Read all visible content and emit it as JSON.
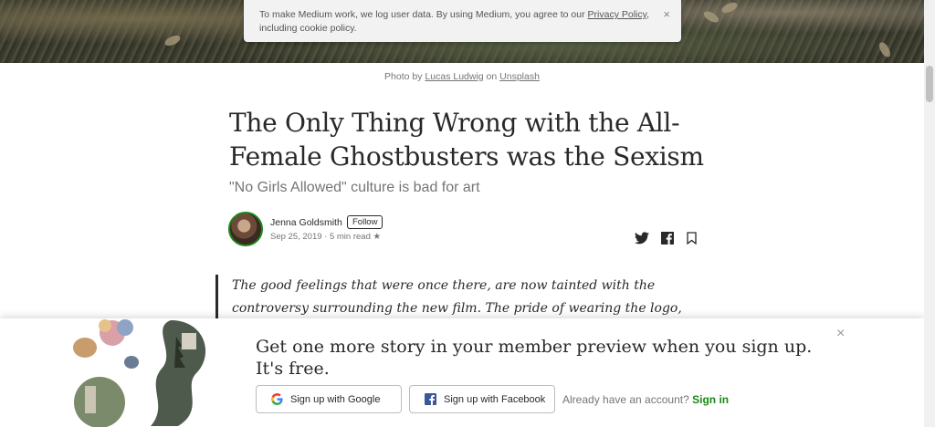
{
  "cookie_banner": {
    "text_before": "To make Medium work, we log user data. By using Medium, you agree to our ",
    "privacy_link": "Privacy Policy",
    "text_after": ",",
    "text_line2": "including cookie policy.",
    "close": "×"
  },
  "photo_caption": {
    "prefix": "Photo by ",
    "photographer": "Lucas Ludwig",
    "mid": " on ",
    "source": "Unsplash"
  },
  "article": {
    "title": "The Only Thing Wrong with the All-Female Ghostbusters was the Sexism",
    "subtitle": "\"No Girls Allowed\" culture is bad for art",
    "author": "Jenna Goldsmith",
    "follow_label": "Follow",
    "meta": "Sep 25, 2019 · 5 min read ★",
    "pullquote": "The good feelings that were once there, are now tainted with the controversy surrounding the new film. The pride of wearing the logo, has now been"
  },
  "share_icons": [
    "twitter-icon",
    "facebook-icon",
    "bookmark-icon"
  ],
  "signup": {
    "headline": "Get one more story in your member preview when you sign up. It's free.",
    "close": "×",
    "google_label": "Sign up with Google",
    "facebook_label": "Sign up with Facebook",
    "already_text": "Already have an account? ",
    "sign_in_label": "Sign in"
  },
  "colors": {
    "accent_green": "#1a8917",
    "text": "#292929",
    "muted": "#757575",
    "facebook_blue": "#3b5998"
  }
}
